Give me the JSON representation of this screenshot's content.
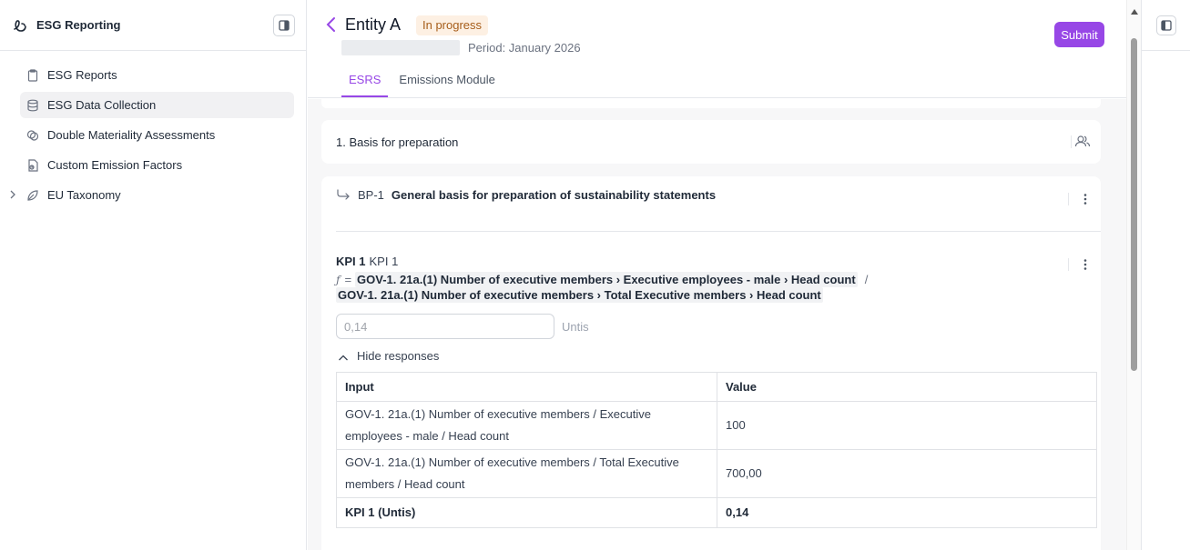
{
  "app": {
    "title": "ESG Reporting"
  },
  "sidebar": {
    "items": [
      {
        "label": "ESG Reports",
        "icon": "clipboard-icon"
      },
      {
        "label": "ESG Data Collection",
        "icon": "database-icon",
        "active": true
      },
      {
        "label": "Double Materiality Assessments",
        "icon": "overlap-circles-icon"
      },
      {
        "label": "Custom Emission Factors",
        "icon": "file-chart-icon"
      },
      {
        "label": "EU Taxonomy",
        "icon": "leaf-icon",
        "expandable": true
      }
    ]
  },
  "header": {
    "title": "Entity A",
    "status": "In progress",
    "period": "Period: January 2026",
    "submit_label": "Submit",
    "tabs": [
      {
        "label": "ESRS",
        "active": true
      },
      {
        "label": "Emissions Module",
        "active": false
      }
    ]
  },
  "section": {
    "title": "1. Basis for preparation"
  },
  "disclosure": {
    "code": "BP-1",
    "title": "General basis for preparation of sustainability statements"
  },
  "kpi": {
    "code": "KPI 1",
    "name": "KPI 1",
    "formula_prefix": "=",
    "numerator": "GOV-1. 21a.(1) Number of executive members › Executive employees - male › Head count",
    "operator": "/",
    "denominator": "GOV-1. 21a.(1) Number of executive members › Total Executive members › Head count",
    "value_placeholder": "0,14",
    "unit": "Untis",
    "toggle_label": "Hide responses"
  },
  "responses": {
    "headers": [
      "Input",
      "Value"
    ],
    "rows": [
      {
        "input": "GOV-1. 21a.(1) Number of executive members / Executive employees - male / Head count",
        "value": "100"
      },
      {
        "input": "GOV-1. 21a.(1) Number of executive members / Total Executive members / Head count",
        "value": "700,00"
      }
    ],
    "total": {
      "input": "KPI 1 (Untis)",
      "value": "0,14"
    }
  },
  "colors": {
    "accent": "#9747e6",
    "badge_bg": "#fdf0e3",
    "badge_text": "#a65d1a"
  }
}
